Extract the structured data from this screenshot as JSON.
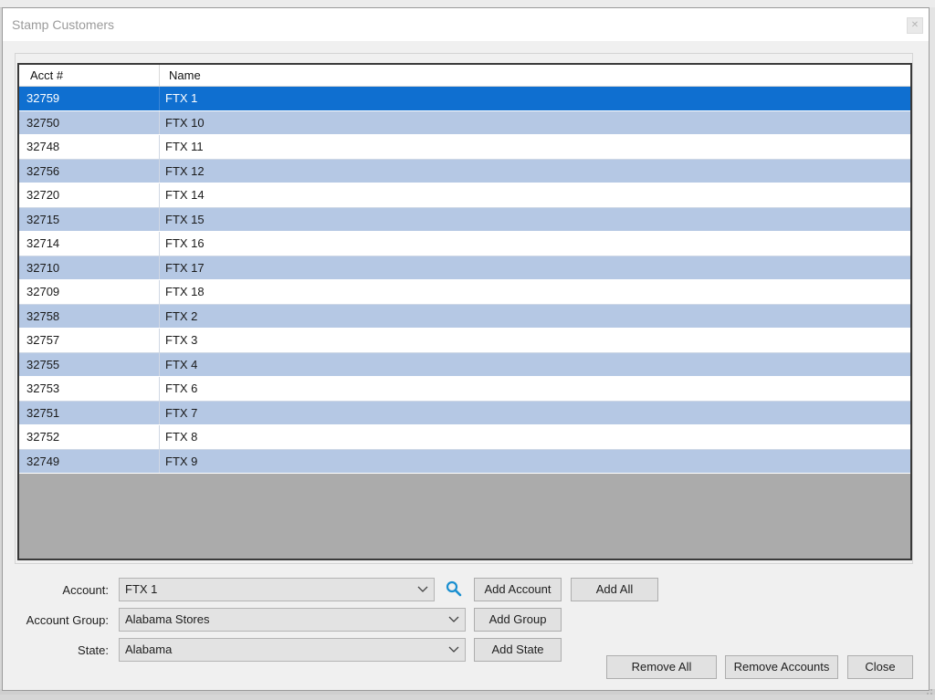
{
  "window": {
    "title": "Stamp Customers",
    "close_glyph": "✕"
  },
  "grid": {
    "columns": [
      "Acct #",
      "Name"
    ],
    "selected_index": 0,
    "rows": [
      {
        "acct": "32759",
        "name": "FTX 1"
      },
      {
        "acct": "32750",
        "name": "FTX 10"
      },
      {
        "acct": "32748",
        "name": "FTX 11"
      },
      {
        "acct": "32756",
        "name": "FTX 12"
      },
      {
        "acct": "32720",
        "name": "FTX 14"
      },
      {
        "acct": "32715",
        "name": "FTX 15"
      },
      {
        "acct": "32714",
        "name": "FTX 16"
      },
      {
        "acct": "32710",
        "name": "FTX 17"
      },
      {
        "acct": "32709",
        "name": "FTX 18"
      },
      {
        "acct": "32758",
        "name": "FTX 2"
      },
      {
        "acct": "32757",
        "name": "FTX 3"
      },
      {
        "acct": "32755",
        "name": "FTX 4"
      },
      {
        "acct": "32753",
        "name": "FTX 6"
      },
      {
        "acct": "32751",
        "name": "FTX 7"
      },
      {
        "acct": "32752",
        "name": "FTX 8"
      },
      {
        "acct": "32749",
        "name": "FTX 9"
      }
    ]
  },
  "form": {
    "account_label": "Account:",
    "account_value": "FTX 1",
    "group_label": "Account Group:",
    "group_value": "Alabama Stores",
    "state_label": "State:",
    "state_value": "Alabama"
  },
  "buttons": {
    "add_account": "Add Account",
    "add_all": "Add All",
    "add_group": "Add Group",
    "add_state": "Add State",
    "remove_all": "Remove All",
    "remove_accounts": "Remove Accounts",
    "close": "Close"
  },
  "colors": {
    "selected_row": "#0f6fd0",
    "alt_row": "#b5c8e4",
    "search_icon": "#1a8fd0"
  },
  "icons": {
    "search": "search-icon",
    "chevron": "chevron-down-icon",
    "close": "close-icon"
  }
}
